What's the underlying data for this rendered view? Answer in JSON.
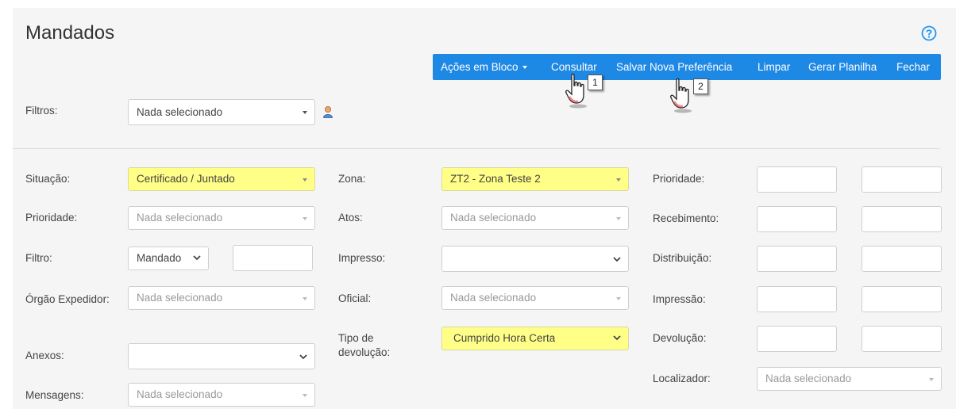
{
  "page": {
    "title": "Mandados"
  },
  "toolbar": {
    "acoes_label": "Ações em Bloco",
    "consultar_label": "Consultar",
    "salvar_label": "Salvar Nova Preferência",
    "limpar_label": "Limpar",
    "gerar_label": "Gerar Planilha",
    "fechar_label": "Fechar"
  },
  "filters": {
    "label": "Filtros:",
    "value": "Nada selecionado"
  },
  "form": {
    "situacao": {
      "label": "Situação:",
      "value": "Certificado / Juntado"
    },
    "prioridade": {
      "label": "Prioridade:",
      "placeholder": "Nada selecionado"
    },
    "filtro": {
      "label": "Filtro:",
      "value": "Mandado"
    },
    "orgao": {
      "label": "Órgão Expedidor:",
      "placeholder": "Nada selecionado"
    },
    "anexos": {
      "label": "Anexos:"
    },
    "mensagens": {
      "label": "Mensagens:",
      "placeholder": "Nada selecionado"
    },
    "zona": {
      "label": "Zona:",
      "value": "ZT2 - Zona Teste 2"
    },
    "atos": {
      "label": "Atos:",
      "placeholder": "Nada selecionado"
    },
    "impresso": {
      "label": "Impresso:"
    },
    "oficial": {
      "label": "Oficial:",
      "placeholder": "Nada selecionado"
    },
    "tipo_devolucao": {
      "label": "Tipo de devolução:",
      "value": "Cumprido Hora Certa"
    },
    "prioridade_range": {
      "label": "Prioridade:"
    },
    "recebimento": {
      "label": "Recebimento:"
    },
    "distribuicao": {
      "label": "Distribuição:"
    },
    "impressao": {
      "label": "Impressão:"
    },
    "devolucao": {
      "label": "Devolução:"
    },
    "localizador": {
      "label": "Localizador:",
      "placeholder": "Nada selecionado"
    }
  },
  "annotations": {
    "badge1": "1",
    "badge2": "2"
  },
  "colors": {
    "toolbar": "#1e88e5",
    "highlight": "#ffff88",
    "help": "#2196f3"
  },
  "icons": [
    "help-circle-icon",
    "user-icon",
    "caret-down-icon",
    "chevron-down-icon",
    "hand-pointer-icon"
  ]
}
